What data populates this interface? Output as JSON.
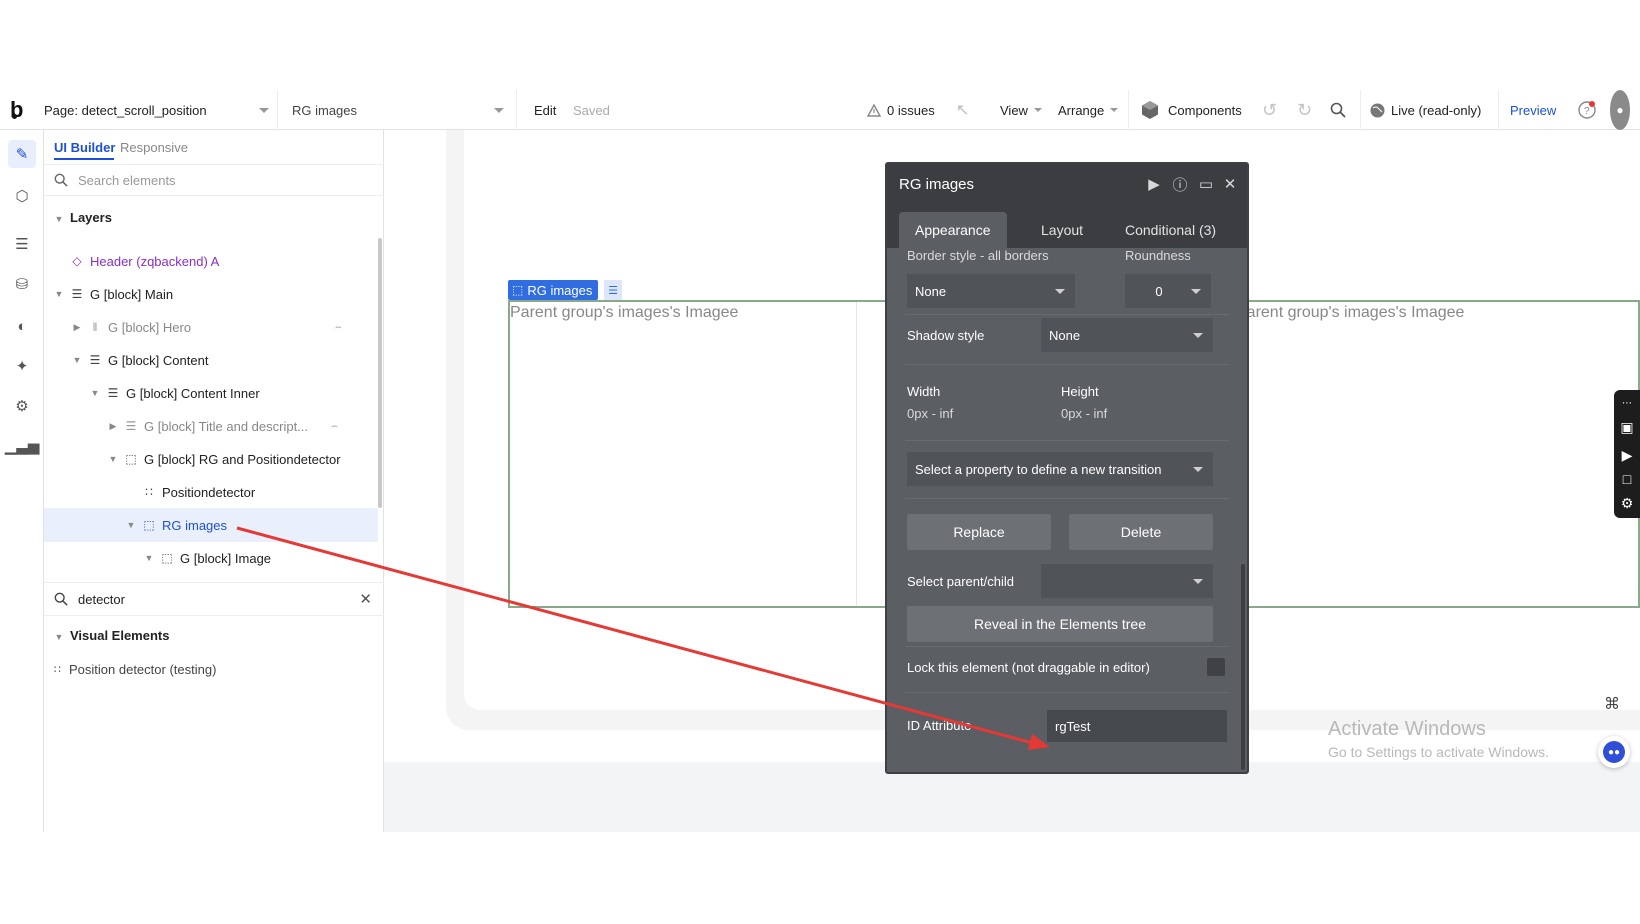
{
  "topbar": {
    "logo": "b",
    "page_select": "Page: detect_scroll_position",
    "element_select": "RG images",
    "edit": "Edit",
    "saved": "Saved",
    "issues": "0 issues",
    "view": "View",
    "arrange": "Arrange",
    "components": "Components",
    "live": "Live (read-only)",
    "preview": "Preview"
  },
  "left_panel": {
    "tab_ui_builder": "UI Builder",
    "tab_responsive": "Responsive",
    "search_placeholder": "Search elements",
    "layers_heading": "Layers",
    "tree": [
      {
        "label": "Header (zqbackend) A",
        "depth": 0
      },
      {
        "label": "G [block] Main",
        "depth": 0
      },
      {
        "label": "G [block] Hero",
        "depth": 1
      },
      {
        "label": "G [block] Content",
        "depth": 1
      },
      {
        "label": "G [block] Content Inner",
        "depth": 2
      },
      {
        "label": "G [block] Title and descript...",
        "depth": 3
      },
      {
        "label": "G [block] RG and Positiondetector",
        "depth": 3
      },
      {
        "label": "Positiondetector",
        "depth": 4
      },
      {
        "label": "RG images",
        "depth": 4
      },
      {
        "label": "G [block] Image",
        "depth": 5
      }
    ],
    "search2_value": "detector",
    "visual_elements_heading": "Visual Elements",
    "visual_element_item": "Position detector (testing)"
  },
  "canvas": {
    "rg_tag": "RG images",
    "cell_text": "Parent group's images's Imagee",
    "activate_title": "Activate Windows",
    "activate_sub": "Go to Settings to activate Windows."
  },
  "property_editor": {
    "title": "RG images",
    "tab_appearance": "Appearance",
    "tab_layout": "Layout",
    "tab_conditional": "Conditional (3)",
    "border_style_label": "Border style - all borders",
    "roundness_label": "Roundness",
    "border_style_value": "None",
    "roundness_value": "0",
    "shadow_label": "Shadow style",
    "shadow_value": "None",
    "width_label": "Width",
    "width_value": "0px - inf",
    "height_label": "Height",
    "height_value": "0px - inf",
    "transition_placeholder": "Select a property to define a new transition",
    "replace_label": "Replace",
    "delete_label": "Delete",
    "select_parent_label": "Select parent/child",
    "reveal_label": "Reveal in the Elements tree",
    "lock_label": "Lock this element (not draggable in editor)",
    "id_attr_label": "ID Attribute",
    "id_attr_value": "rgTest"
  },
  "colors": {
    "accent": "#1e4fd8",
    "annotation_arrow": "#e53935",
    "editor_bg": "#5b5e62"
  }
}
